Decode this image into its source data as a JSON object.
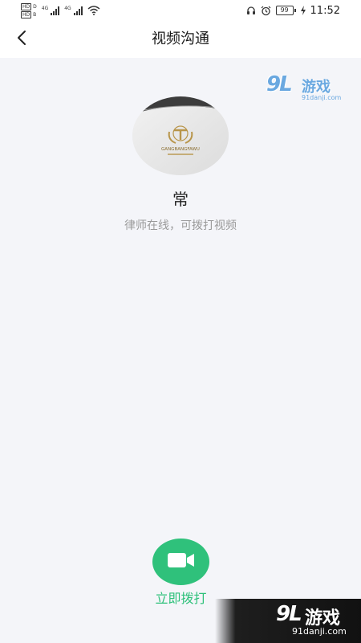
{
  "status_bar": {
    "hd_label": "HD",
    "hd_top_num": "D",
    "hd_bottom_num": "B",
    "signal1_label": "4G",
    "signal2_label": "4G",
    "battery_level": "99",
    "time": "11:52"
  },
  "header": {
    "title": "视频沟通",
    "back_icon": "chevron-left-icon"
  },
  "watermark_top": {
    "logo": "9L",
    "name": "游戏",
    "url": "91danji.com"
  },
  "lawyer": {
    "avatar_text": "GANGBANGFAWU",
    "name": "常",
    "status": "律师在线，可拨打视频"
  },
  "call": {
    "icon": "video-camera-icon",
    "label": "立即拨打"
  },
  "watermark_bottom": {
    "logo": "9L",
    "name": "游戏",
    "url": "91danji.com"
  },
  "colors": {
    "accent": "#2fc17b",
    "background": "#f4f5f9",
    "muted_text": "#9a9a9a"
  }
}
